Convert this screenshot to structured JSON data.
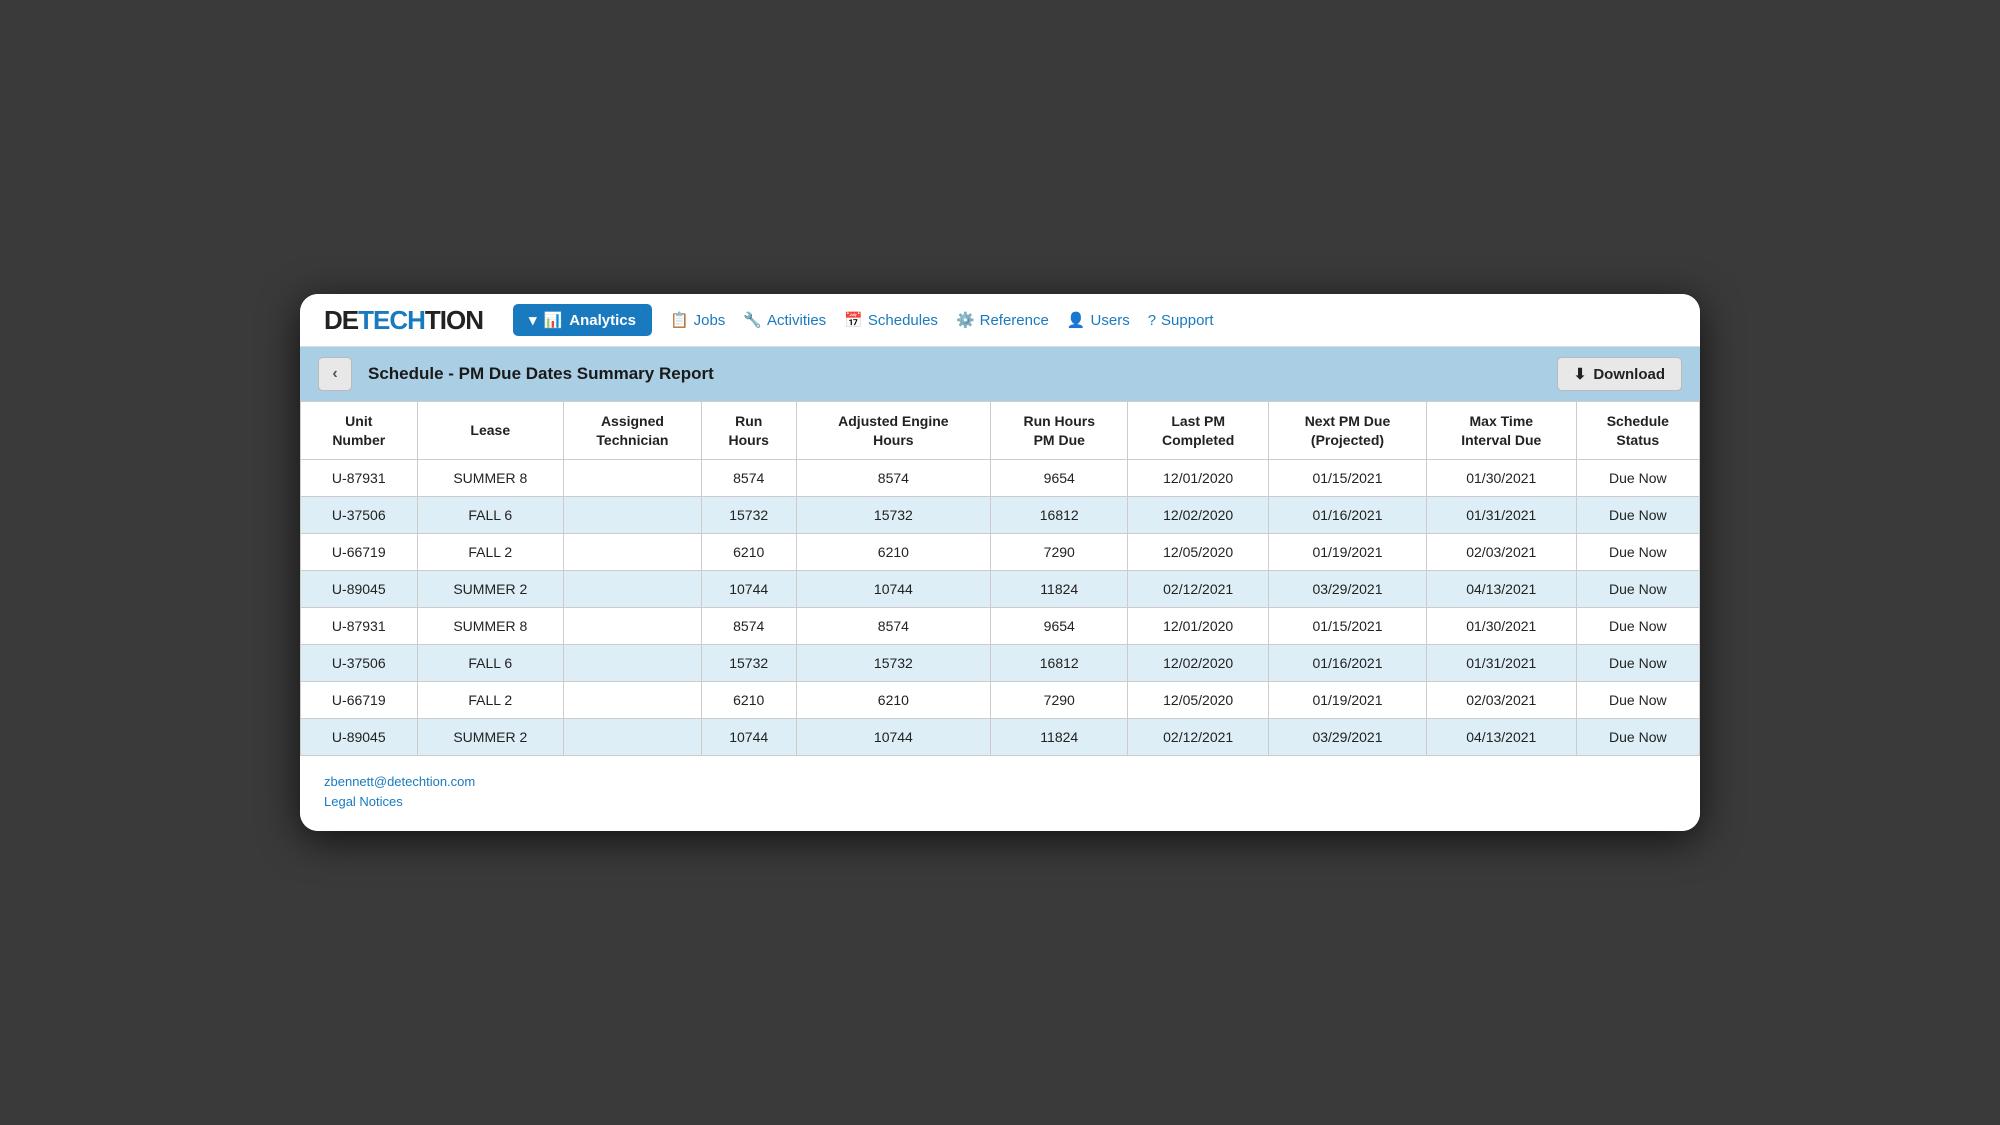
{
  "logo": {
    "de": "DE",
    "tech": "TECH",
    "tion": "TION"
  },
  "navbar": {
    "analytics_label": "Analytics",
    "jobs_label": "Jobs",
    "activities_label": "Activities",
    "schedules_label": "Schedules",
    "reference_label": "Reference",
    "users_label": "Users",
    "support_label": "Support"
  },
  "report_header": {
    "back_label": "‹",
    "title": "Schedule - PM Due Dates Summary Report",
    "download_label": "Download"
  },
  "table": {
    "columns": [
      "Unit Number",
      "Lease",
      "Assigned Technician",
      "Run Hours",
      "Adjusted Engine Hours",
      "Run Hours PM Due",
      "Last PM Completed",
      "Next PM Due (Projected)",
      "Max Time Interval Due",
      "Schedule Status"
    ],
    "rows": [
      [
        "U-87931",
        "SUMMER 8",
        "",
        "8574",
        "8574",
        "9654",
        "12/01/2020",
        "01/15/2021",
        "01/30/2021",
        "Due Now"
      ],
      [
        "U-37506",
        "FALL 6",
        "",
        "15732",
        "15732",
        "16812",
        "12/02/2020",
        "01/16/2021",
        "01/31/2021",
        "Due Now"
      ],
      [
        "U-66719",
        "FALL 2",
        "",
        "6210",
        "6210",
        "7290",
        "12/05/2020",
        "01/19/2021",
        "02/03/2021",
        "Due Now"
      ],
      [
        "U-89045",
        "SUMMER 2",
        "",
        "10744",
        "10744",
        "11824",
        "02/12/2021",
        "03/29/2021",
        "04/13/2021",
        "Due Now"
      ],
      [
        "U-87931",
        "SUMMER 8",
        "",
        "8574",
        "8574",
        "9654",
        "12/01/2020",
        "01/15/2021",
        "01/30/2021",
        "Due Now"
      ],
      [
        "U-37506",
        "FALL 6",
        "",
        "15732",
        "15732",
        "16812",
        "12/02/2020",
        "01/16/2021",
        "01/31/2021",
        "Due Now"
      ],
      [
        "U-66719",
        "FALL 2",
        "",
        "6210",
        "6210",
        "7290",
        "12/05/2020",
        "01/19/2021",
        "02/03/2021",
        "Due Now"
      ],
      [
        "U-89045",
        "SUMMER 2",
        "",
        "10744",
        "10744",
        "11824",
        "02/12/2021",
        "03/29/2021",
        "04/13/2021",
        "Due Now"
      ]
    ]
  },
  "footer": {
    "email": "zbennett@detechtion.com",
    "legal": "Legal Notices"
  }
}
